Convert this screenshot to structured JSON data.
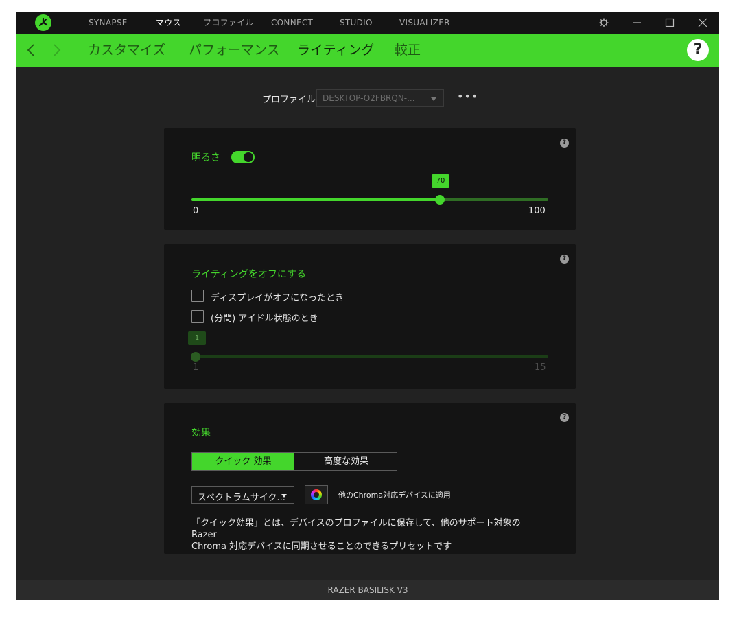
{
  "nav": {
    "tabs": [
      {
        "label": "SYNAPSE",
        "active": false
      },
      {
        "label": "マウス",
        "active": true
      },
      {
        "label": "プロファイル",
        "active": false
      },
      {
        "label": "CONNECT",
        "active": false
      },
      {
        "label": "STUDIO",
        "active": false
      },
      {
        "label": "VISUALIZER",
        "active": false
      }
    ]
  },
  "subnav": {
    "tabs": [
      {
        "label": "カスタマイズ"
      },
      {
        "label": "パフォーマンス"
      },
      {
        "label": "ライティング",
        "active": true
      },
      {
        "label": "較正"
      }
    ],
    "help": "?"
  },
  "profile": {
    "label": "プロファイル",
    "value": "DESKTOP-O2FBRQN-...",
    "more": "•••"
  },
  "brightness": {
    "title": "明るさ",
    "enabled": true,
    "value": "70",
    "min": "0",
    "max": "100",
    "help": "?"
  },
  "lighting_off": {
    "title": "ライティングをオフにする",
    "options": [
      {
        "label": "ディスプレイがオフになったとき",
        "checked": false
      },
      {
        "label": "(分間) アイドル状態のとき",
        "checked": false
      }
    ],
    "idle_value": "1",
    "min": "1",
    "max": "15",
    "help": "?"
  },
  "effects": {
    "title": "効果",
    "modes": [
      "クイック 効果",
      "高度な効果"
    ],
    "selected": "スペクトラムサイク...",
    "apply_label": "他のChroma対応デバイスに適用",
    "description_line1": "「クイック効果」とは、デバイスのプロファイルに保存して、他のサポート対象の Razer",
    "description_line2": "Chroma 対応デバイスに同期させることのできるプリセットです",
    "help": "?"
  },
  "footer": {
    "device": "RAZER BASILISK V3"
  },
  "colors": {
    "accent": "#44d62c",
    "background": "#222222",
    "panel": "#141414"
  }
}
